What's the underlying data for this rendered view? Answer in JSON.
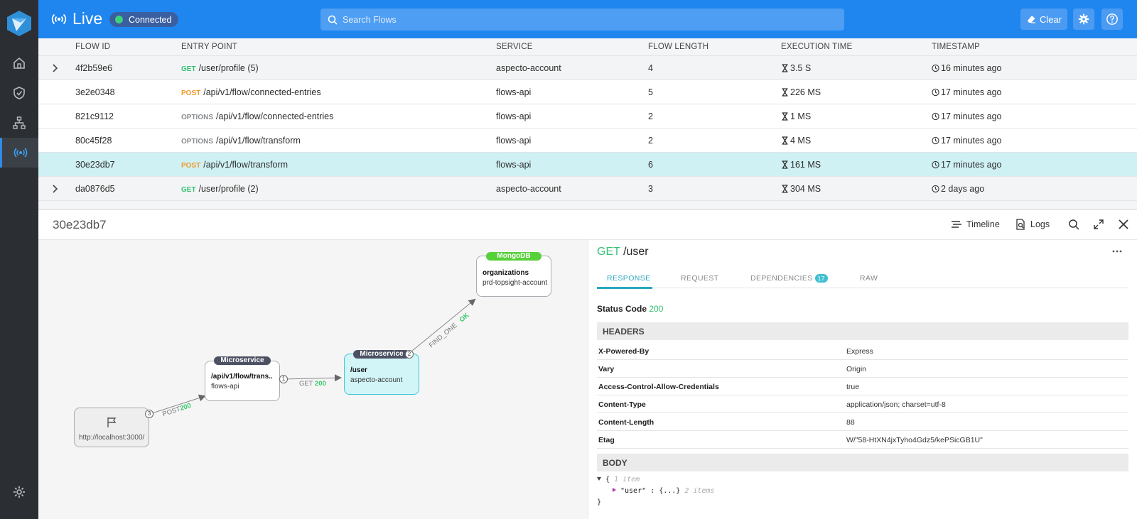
{
  "app": {
    "title": "Live",
    "connection_status": "Connected",
    "search_placeholder": "Search Flows",
    "clear_label": "Clear",
    "accent": "#1f86f0",
    "connected_color": "#3dd27a"
  },
  "sidebar": {
    "items": [
      {
        "icon": "home-icon"
      },
      {
        "icon": "shield-check-icon"
      },
      {
        "icon": "sitemap-icon"
      },
      {
        "icon": "live-broadcast-icon",
        "active": true
      }
    ],
    "footer_icon": "gear-icon"
  },
  "table": {
    "headers": [
      "FLOW ID",
      "ENTRY POINT",
      "SERVICE",
      "FLOW LENGTH",
      "EXECUTION TIME",
      "TIMESTAMP"
    ],
    "rows": [
      {
        "id": "4f2b59e6",
        "method": "GET",
        "path": "/user/profile (5)",
        "service": "aspecto-account",
        "length": "4",
        "time": "3.5 S",
        "timestamp": "16 minutes ago"
      },
      {
        "id": "3e2e0348",
        "method": "POST",
        "path": "/api/v1/flow/connected-entries",
        "service": "flows-api",
        "length": "5",
        "time": "226 MS",
        "timestamp": "17 minutes ago"
      },
      {
        "id": "821c9112",
        "method": "OPTIONS",
        "path": "/api/v1/flow/connected-entries",
        "service": "flows-api",
        "length": "2",
        "time": "1 MS",
        "timestamp": "17 minutes ago"
      },
      {
        "id": "80c45f28",
        "method": "OPTIONS",
        "path": "/api/v1/flow/transform",
        "service": "flows-api",
        "length": "2",
        "time": "4 MS",
        "timestamp": "17 minutes ago"
      },
      {
        "id": "30e23db7",
        "method": "POST",
        "path": "/api/v1/flow/transform",
        "service": "flows-api",
        "length": "6",
        "time": "161 MS",
        "timestamp": "17 minutes ago"
      },
      {
        "id": "da0876d5",
        "method": "GET",
        "path": "/user/profile (2)",
        "service": "aspecto-account",
        "length": "3",
        "time": "304 MS",
        "timestamp": "2 days ago"
      }
    ]
  },
  "detail": {
    "flow_id": "30e23db7",
    "timeline_label": "Timeline",
    "logs_label": "Logs",
    "graph": {
      "origin_label": "http://localhost:3000/",
      "origin_port": "3",
      "edge1_method": "POST",
      "edge1_status": "200",
      "node1_tag": "Microservice",
      "node1_title": "/api/v1/flow/trans..",
      "node1_sub": "flows-api",
      "node1_port": "1",
      "edge2_method": "GET",
      "edge2_status": "200",
      "node2_tag": "Microservice",
      "node2_title": "/user",
      "node2_sub": "aspecto-account",
      "node2_port": "2",
      "edge3_method": "FIND_ONE",
      "edge3_status": "OK",
      "node3_tag": "MongoDB",
      "node3_title": "organizations",
      "node3_sub": "prd-topsight-account"
    },
    "response": {
      "method": "GET",
      "path": "/user",
      "tabs": [
        "RESPONSE",
        "REQUEST",
        "DEPENDENCIES",
        "RAW"
      ],
      "dependencies_count": "17",
      "status_label": "Status Code",
      "status_code": "200",
      "headers_title": "HEADERS",
      "headers": [
        {
          "key": "X-Powered-By",
          "value": "Express"
        },
        {
          "key": "Vary",
          "value": "Origin"
        },
        {
          "key": "Access-Control-Allow-Credentials",
          "value": "true"
        },
        {
          "key": "Content-Type",
          "value": "application/json; charset=utf-8"
        },
        {
          "key": "Content-Length",
          "value": "88"
        },
        {
          "key": "Etag",
          "value": "W/\"58-HtXN4jxTyho4Gdz5/kePSicGB1U\""
        }
      ],
      "body_title": "BODY",
      "body": {
        "open": "{",
        "open_meta": "1 item",
        "key": "\"user\"",
        "sep": ":",
        "collapsed": "{...}",
        "collapsed_meta": "2 items",
        "close": "}"
      }
    }
  }
}
